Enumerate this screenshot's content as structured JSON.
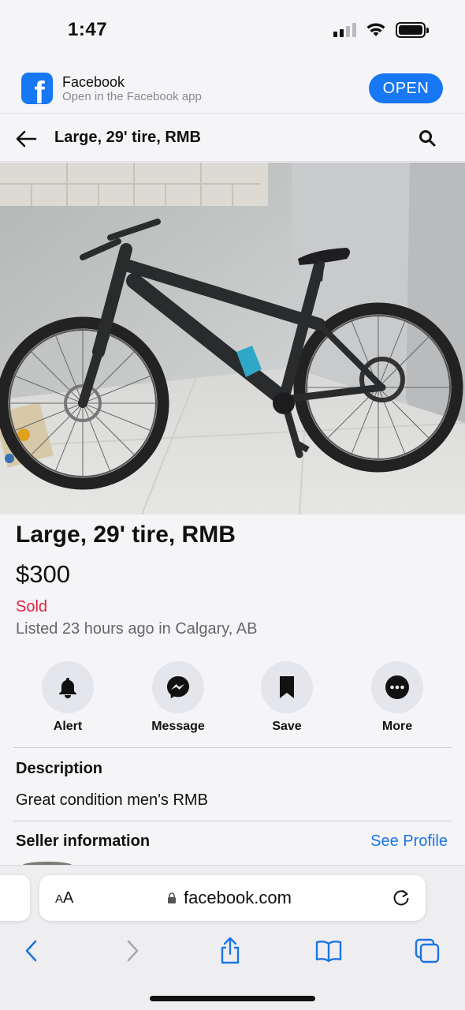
{
  "status_bar": {
    "time": "1:47",
    "icons": [
      "cellular-signal-icon",
      "wifi-icon",
      "battery-icon"
    ]
  },
  "app_banner": {
    "app_name": "Facebook",
    "subtitle": "Open in the Facebook app",
    "open_label": "OPEN",
    "logo_glyph": "f"
  },
  "header": {
    "title": "Large, 29' tire, RMB"
  },
  "listing": {
    "title": "Large, 29' tire, RMB",
    "price": "$300",
    "status": "Sold",
    "listed": "Listed 23 hours ago in Calgary, AB"
  },
  "actions": [
    {
      "label": "Alert",
      "icon": "bell-icon"
    },
    {
      "label": "Message",
      "icon": "messenger-icon"
    },
    {
      "label": "Save",
      "icon": "bookmark-icon"
    },
    {
      "label": "More",
      "icon": "more-icon"
    }
  ],
  "description": {
    "heading": "Description",
    "text": "Great condition men's RMB"
  },
  "seller": {
    "heading": "Seller information",
    "see_profile": "See Profile"
  },
  "browser": {
    "aa_small": "A",
    "aa_large": "A",
    "url": "facebook.com"
  },
  "colors": {
    "facebook_blue": "#1877f2",
    "link_blue": "#1b74e4",
    "sold_red": "#e41e3f",
    "muted_text": "#65676b"
  }
}
